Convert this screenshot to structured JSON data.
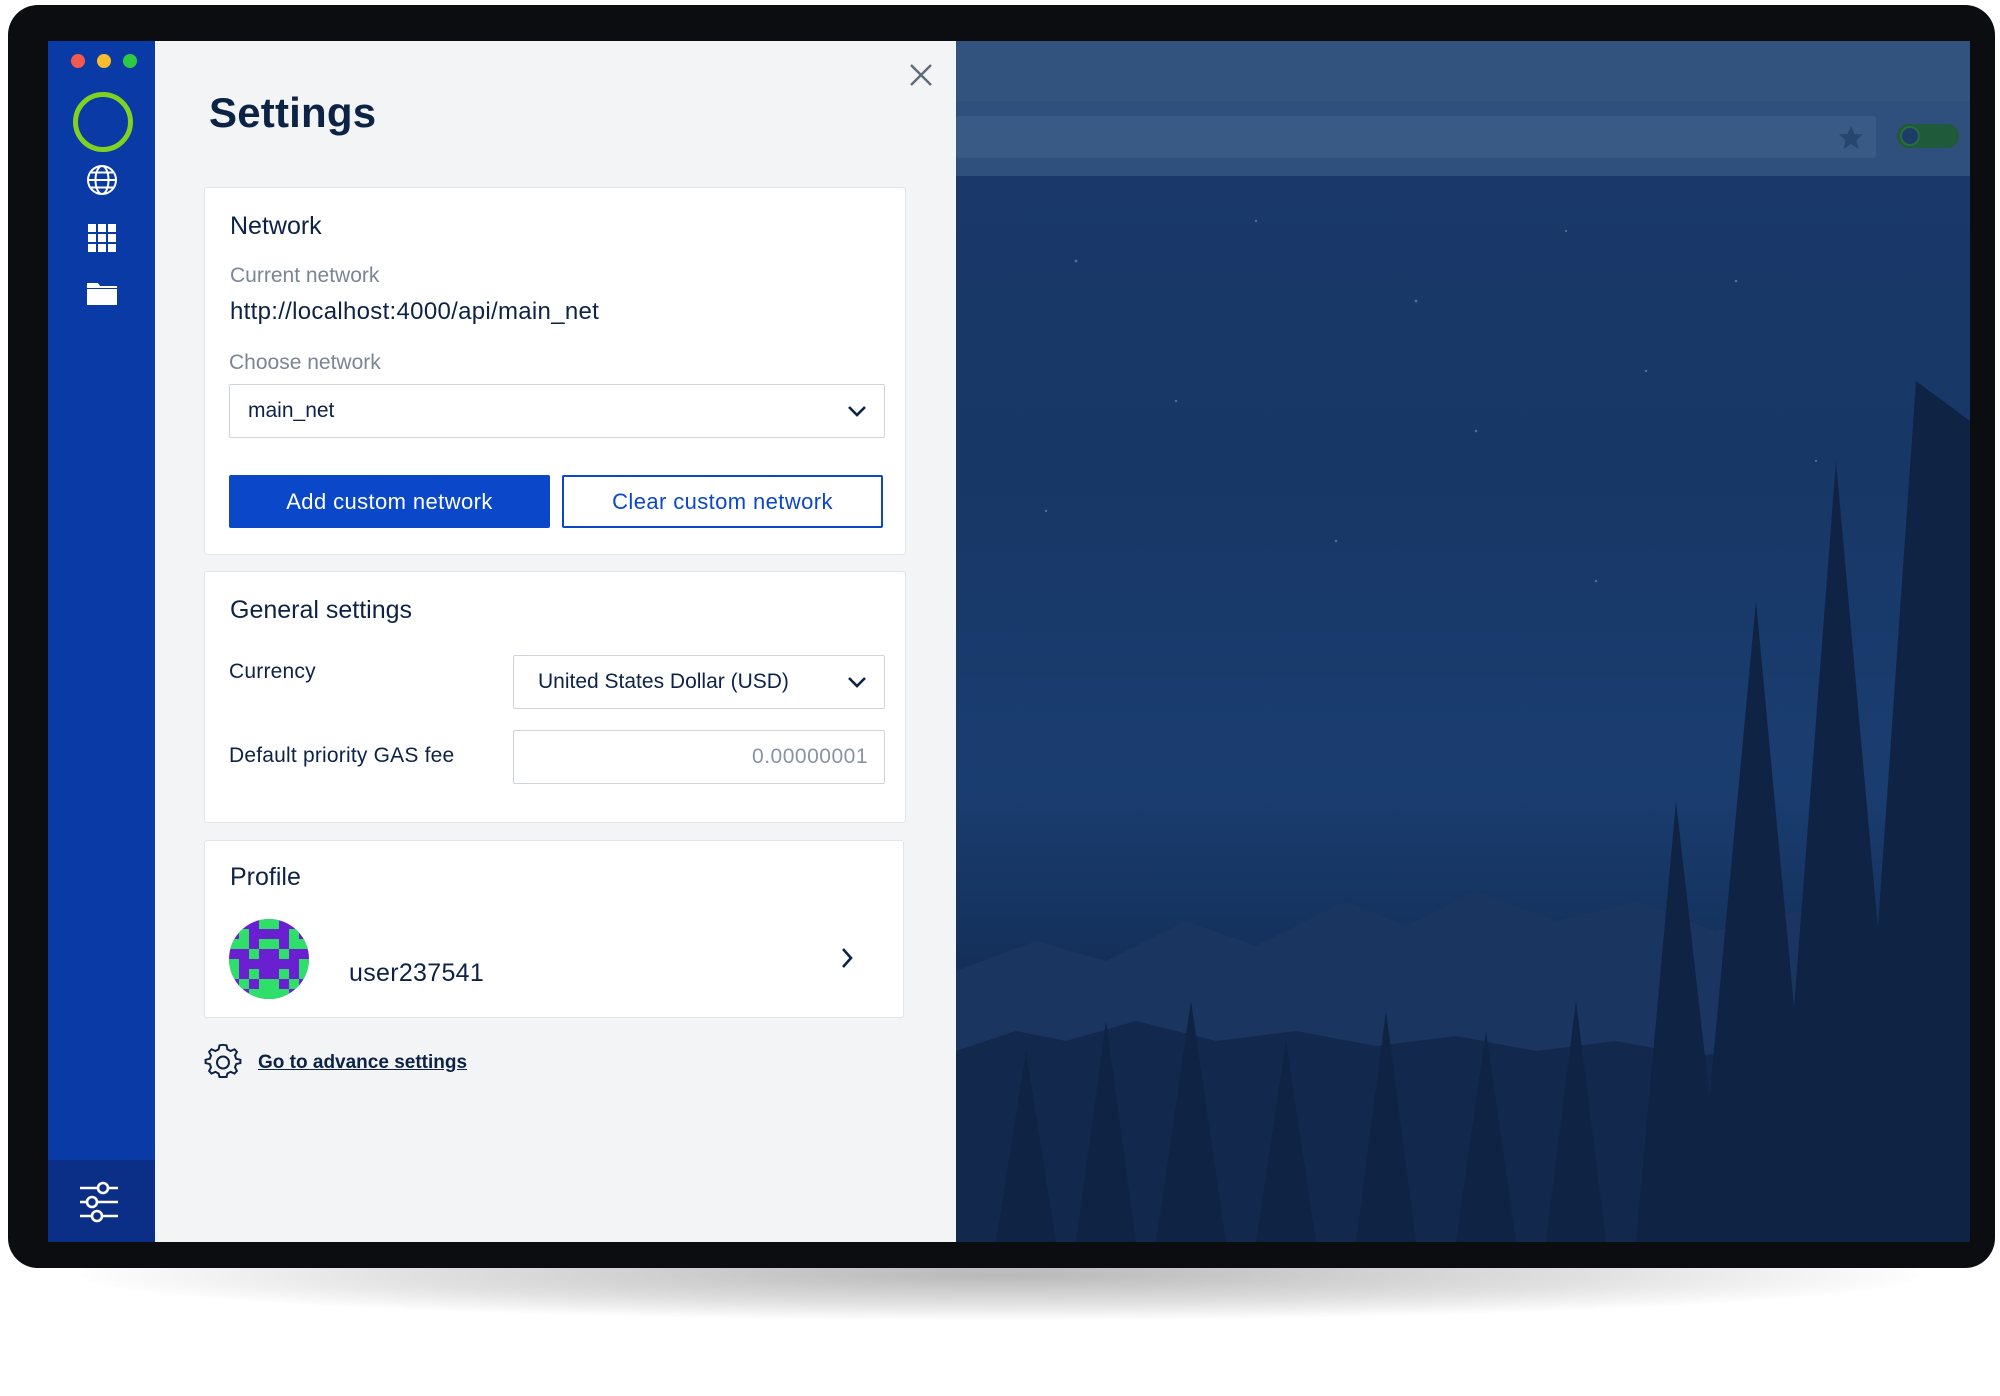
{
  "window": {
    "traffic_lights": [
      "#f35a4f",
      "#f6be2f",
      "#2fca44"
    ]
  },
  "sidebar": {
    "logo_icon": "ring-logo-icon",
    "items": [
      {
        "name": "browse",
        "icon": "globe-icon"
      },
      {
        "name": "apps",
        "icon": "grid-icon"
      },
      {
        "name": "files",
        "icon": "folder-icon"
      }
    ],
    "bottom_item": {
      "name": "settings",
      "icon": "sliders-icon",
      "active": true
    }
  },
  "settings": {
    "title": "Settings",
    "close_icon": "close-icon",
    "network": {
      "heading": "Network",
      "current_label": "Current network",
      "current_value": "http://localhost:4000/api/main_net",
      "choose_label": "Choose network",
      "selected": "main_net",
      "add_button": "Add custom network",
      "clear_button": "Clear custom network"
    },
    "general": {
      "heading": "General settings",
      "currency_label": "Currency",
      "currency_value": "United States Dollar (USD)",
      "gas_label": "Default priority GAS fee",
      "gas_placeholder": "0.00000001"
    },
    "profile": {
      "heading": "Profile",
      "username": "user237541"
    },
    "advanced": {
      "link_text": "Go to advance settings",
      "icon": "gear-icon"
    }
  },
  "background": {
    "toggle_icon": "toggle-icon",
    "star_icon": "star-icon"
  },
  "colors": {
    "accent": "#0a48c9",
    "sidebar": "#0a3aa6",
    "logo": "#7ed321",
    "text": "#0c2346"
  }
}
